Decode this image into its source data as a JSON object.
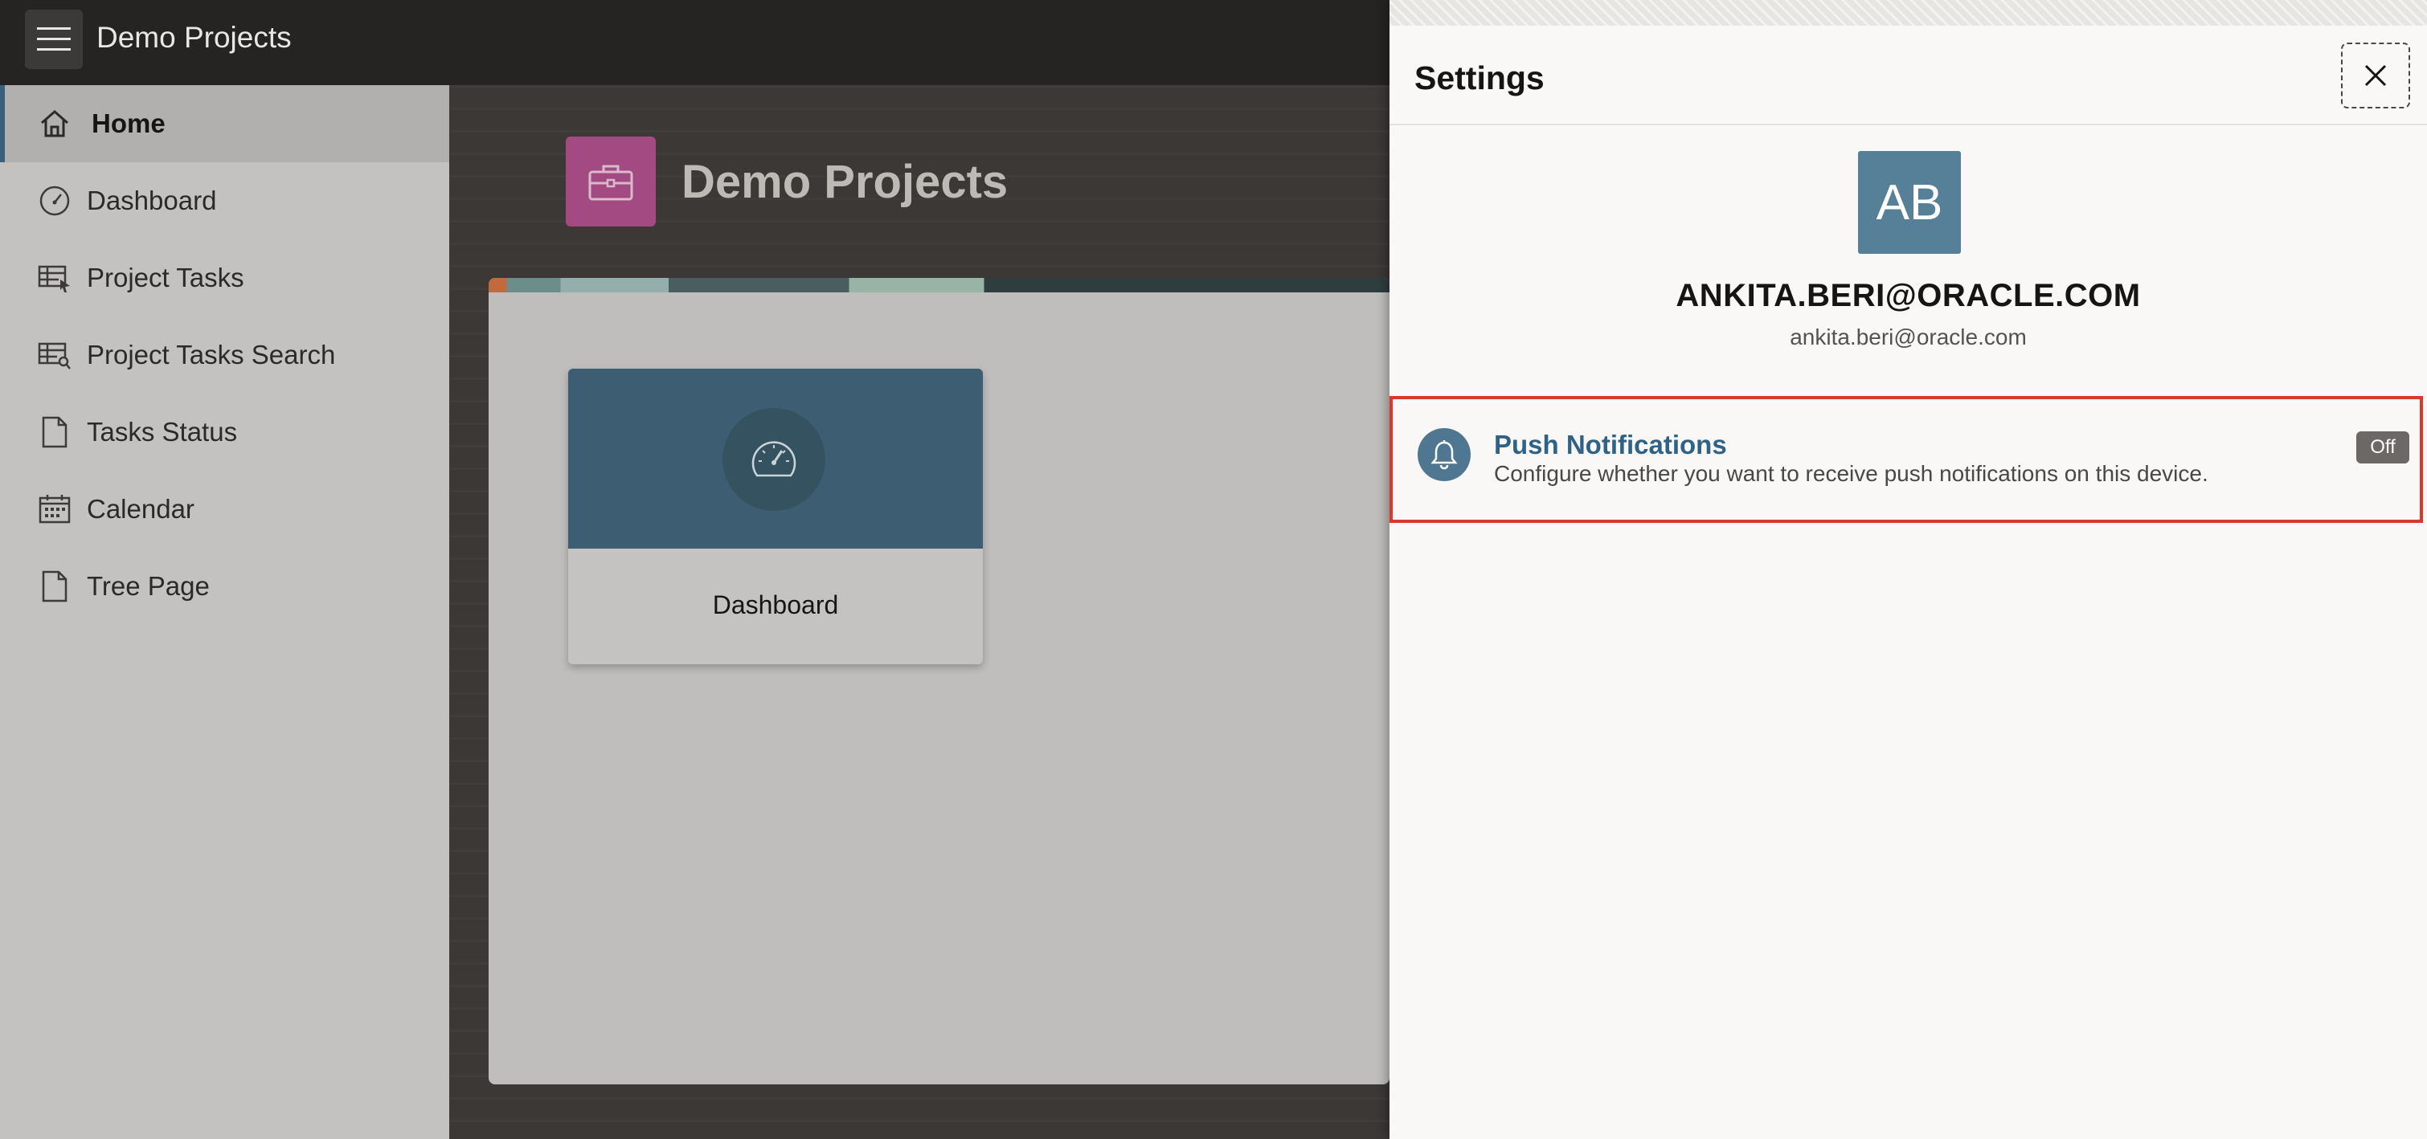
{
  "header": {
    "app_title": "Demo Projects",
    "menu_icon": "hamburger-menu-icon"
  },
  "sidebar": {
    "items": [
      {
        "label": "Home",
        "icon": "home-icon",
        "active": true
      },
      {
        "label": "Dashboard",
        "icon": "speedometer-icon",
        "active": false
      },
      {
        "label": "Project Tasks",
        "icon": "grid-cursor-icon",
        "active": false
      },
      {
        "label": "Project Tasks Search",
        "icon": "grid-search-icon",
        "active": false
      },
      {
        "label": "Tasks Status",
        "icon": "document-icon",
        "active": false
      },
      {
        "label": "Calendar",
        "icon": "calendar-icon",
        "active": false
      },
      {
        "label": "Tree Page",
        "icon": "document-icon",
        "active": false
      }
    ]
  },
  "main": {
    "page_title": "Demo Projects",
    "page_icon": "briefcase-icon",
    "cards": [
      {
        "label": "Dashboard",
        "icon": "speedometer-icon"
      }
    ]
  },
  "settings": {
    "title": "Settings",
    "close_icon": "close-icon",
    "avatar_initials": "AB",
    "user_name": "ANKITA.BERI@ORACLE.COM",
    "user_email": "ankita.beri@oracle.com",
    "push_notifications": {
      "title": "Push Notifications",
      "description": "Configure whether you want to receive push notifications on this device.",
      "status": "Off",
      "icon": "bell-icon"
    }
  },
  "colors": {
    "header_bg": "#262422",
    "sidebar_bg": "#c3c2c1",
    "active_indicator": "#3a5f7b",
    "page_icon_bg": "#a34a82",
    "card_top_bg": "#3d5e72",
    "avatar_bg": "#567f98",
    "highlight_border": "#d9392a",
    "link_blue": "#2e6287"
  }
}
